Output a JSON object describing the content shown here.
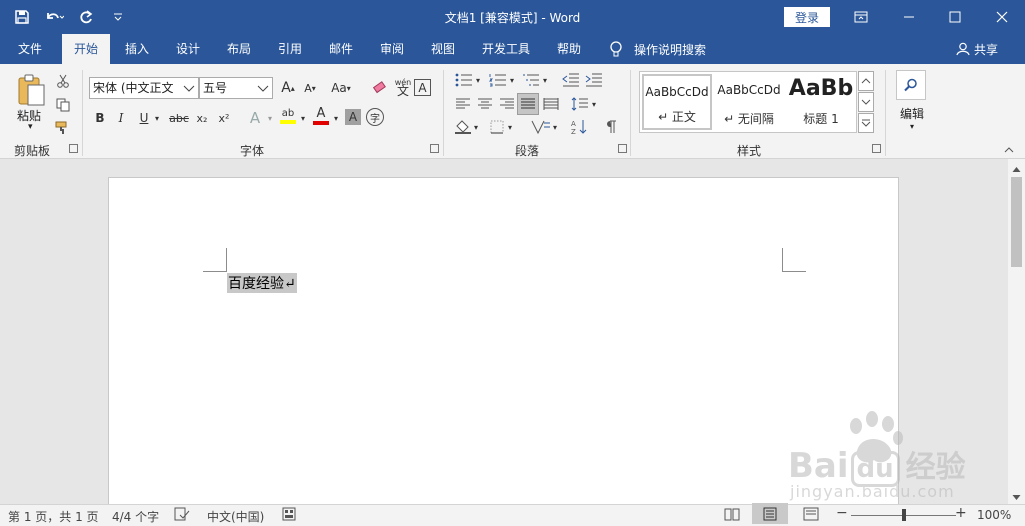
{
  "window": {
    "title": "文档1 [兼容模式] - Word",
    "login": "登录"
  },
  "qat": {
    "save_icon": "save-icon",
    "undo_icon": "undo-icon",
    "redo_icon": "redo-icon",
    "customize_icon": "customize-qat-icon"
  },
  "tabs": [
    {
      "label": "文件"
    },
    {
      "label": "开始"
    },
    {
      "label": "插入"
    },
    {
      "label": "设计"
    },
    {
      "label": "布局"
    },
    {
      "label": "引用"
    },
    {
      "label": "邮件"
    },
    {
      "label": "审阅"
    },
    {
      "label": "视图"
    },
    {
      "label": "开发工具"
    },
    {
      "label": "帮助"
    }
  ],
  "tell_me": "操作说明搜索",
  "share": "共享",
  "ribbon": {
    "clipboard": {
      "paste": "粘贴",
      "label": "剪贴板"
    },
    "font": {
      "label": "字体",
      "font_name": "宋体 (中文正文",
      "font_size": "五号",
      "grow": "A",
      "shrink": "A",
      "case": "Aa",
      "phonetic_top": "wén",
      "phonetic": "文",
      "bold": "B",
      "italic": "I",
      "underline": "U",
      "strike": "abc",
      "sub": "x₂",
      "sup": "x²",
      "effect": "A",
      "highlight": "ab",
      "color": "A",
      "shading": "A",
      "enclose": "字"
    },
    "paragraph": {
      "label": "段落"
    },
    "styles": {
      "label": "样式",
      "items": [
        {
          "sample": "AaBbCcDd",
          "name": "↵ 正文"
        },
        {
          "sample": "AaBbCcDd",
          "name": "↵ 无间隔"
        },
        {
          "sample": "AaBb",
          "name": "标题 1"
        }
      ]
    },
    "editing": {
      "label": "编辑"
    }
  },
  "document": {
    "text": "百度经验↵"
  },
  "watermark": {
    "brand": "Bai",
    "brand2": "du",
    "jingyan": "经验",
    "url": "jingyan.baidu.com"
  },
  "status": {
    "page": "第 1 页，共 1 页",
    "words": "4/4 个字",
    "language": "中文(中国)",
    "zoom": "100%",
    "zoom_level": 100
  },
  "colors": {
    "accent": "#2b579a",
    "highlight": "#ffff00",
    "font_color": "#e00000"
  }
}
